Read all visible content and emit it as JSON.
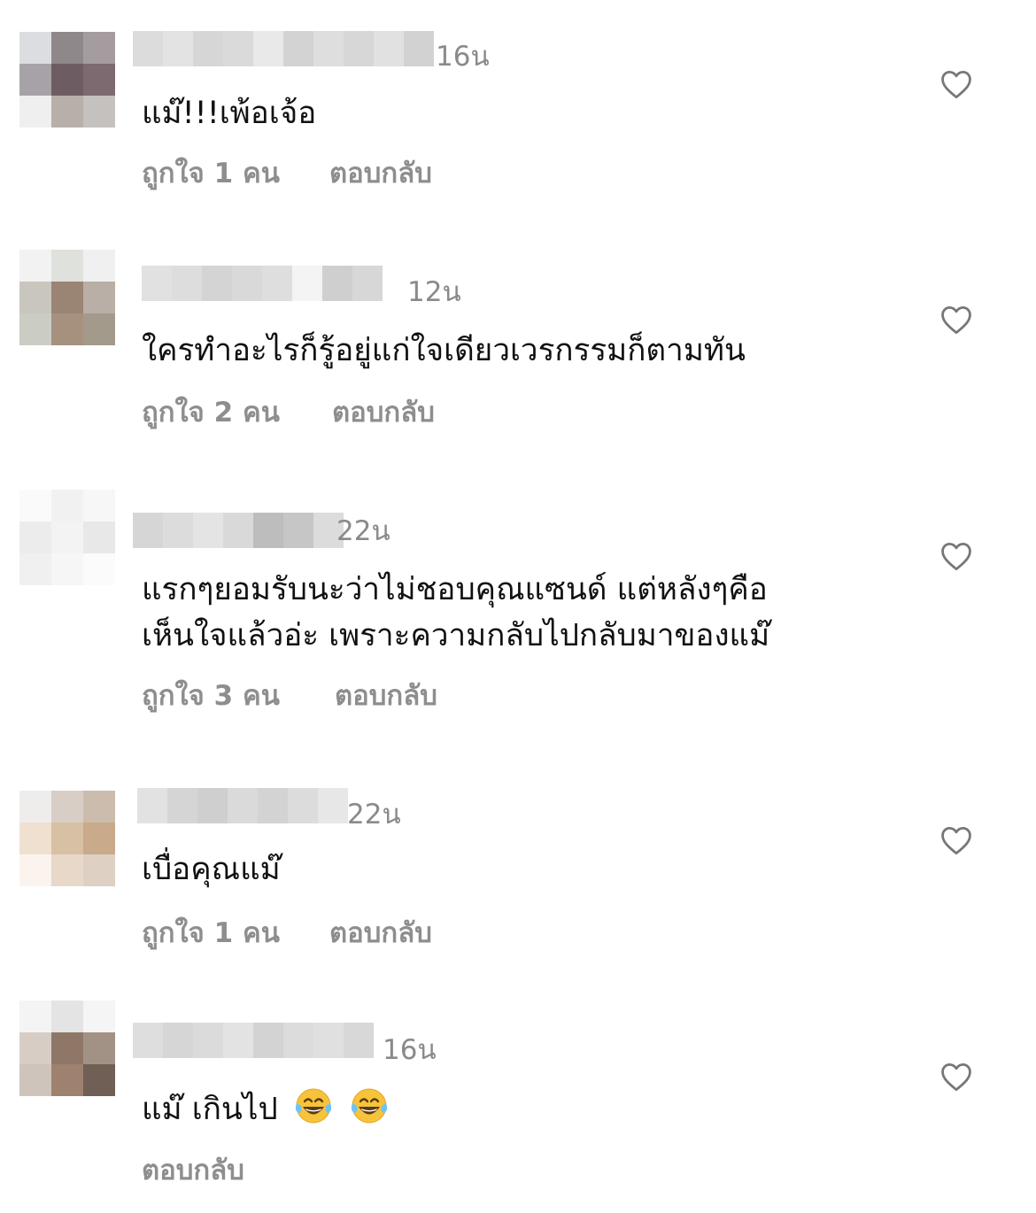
{
  "comments": [
    {
      "time": "16น",
      "text": "แม๊!!!เพ้อเจ้อ",
      "likes": "ถูกใจ 1 คน",
      "reply": "ตอบกลับ"
    },
    {
      "time": "12น",
      "text": "ใครทำอะไรก็รู้อยู่แก่ใจเดียวเวรกรรมก็ตามทัน",
      "likes": "ถูกใจ 2 คน",
      "reply": "ตอบกลับ"
    },
    {
      "time": "22น",
      "text_line1": "แรกๆยอมรับนะว่าไม่ชอบคุณแซนด์ แต่หลังๆคือ",
      "text_line2": "เห็นใจแล้วอ่ะ เพราะความกลับไปกลับมาของแม๊",
      "likes": "ถูกใจ 3 คน",
      "reply": "ตอบกลับ"
    },
    {
      "time": "22น",
      "text": "เบื่อคุณแม๊",
      "likes": "ถูกใจ 1 คน",
      "reply": "ตอบกลับ"
    },
    {
      "time": "16น",
      "text": "แม๊ เกินไป",
      "emoji": [
        "tears-of-joy-emoji",
        "tears-of-joy-emoji"
      ],
      "reply": "ตอบกลับ"
    }
  ],
  "icons": {
    "like": "heart-outline-icon"
  },
  "colors": {
    "text": "#111111",
    "secondary": "#8e8e8e",
    "background": "#ffffff"
  }
}
